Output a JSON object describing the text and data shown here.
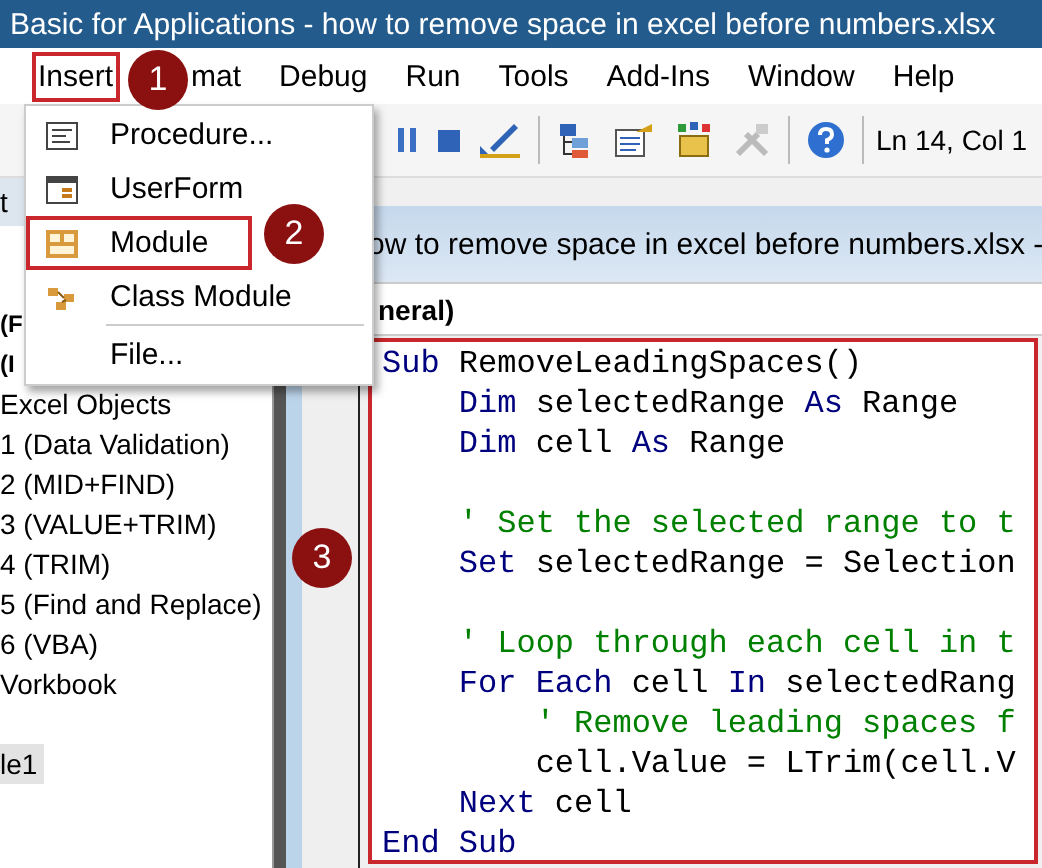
{
  "window": {
    "title": "Basic for Applications - how to remove space in excel before numbers.xlsx"
  },
  "menu_bar": {
    "items": [
      {
        "label": "Insert",
        "marked": true
      },
      {
        "label": "mat",
        "marked": false
      },
      {
        "label": "Debug",
        "marked": false
      },
      {
        "label": "Run",
        "marked": false
      },
      {
        "label": "Tools",
        "marked": false
      },
      {
        "label": "Add-Ins",
        "marked": false
      },
      {
        "label": "Window",
        "marked": false
      },
      {
        "label": "Help",
        "marked": false
      }
    ]
  },
  "insert_menu": {
    "items": [
      {
        "kind": "item",
        "label": "Procedure...",
        "marked": false
      },
      {
        "kind": "item",
        "label": "UserForm",
        "marked": false
      },
      {
        "kind": "item",
        "label": "Module",
        "marked": true
      },
      {
        "kind": "item",
        "label": "Class Module",
        "marked": false
      },
      {
        "kind": "separator"
      },
      {
        "kind": "item",
        "label": "File...",
        "marked": false
      }
    ]
  },
  "toolbar": {
    "position": "Ln 14, Col 1"
  },
  "project_pane": {
    "header": "t",
    "items": [
      {
        "label": "(F",
        "bold": true,
        "selected": false
      },
      {
        "label": "(I",
        "bold": true,
        "selected": false
      },
      {
        "label": "Excel Objects",
        "bold": false,
        "selected": false
      },
      {
        "label": "1 (Data Validation)",
        "bold": false,
        "selected": false
      },
      {
        "label": "2 (MID+FIND)",
        "bold": false,
        "selected": false
      },
      {
        "label": "3 (VALUE+TRIM)",
        "bold": false,
        "selected": false
      },
      {
        "label": "4 (TRIM)",
        "bold": false,
        "selected": false
      },
      {
        "label": "5 (Find and Replace)",
        "bold": false,
        "selected": false
      },
      {
        "label": "6 (VBA)",
        "bold": false,
        "selected": false
      },
      {
        "label": "Vorkbook",
        "bold": false,
        "selected": false
      },
      {
        "label": "le1",
        "bold": false,
        "selected": true
      }
    ]
  },
  "code_window": {
    "title": "ow to remove space in excel before numbers.xlsx -",
    "object_box": "neral)",
    "marked": true,
    "lines": [
      {
        "kind": "code",
        "segments": [
          {
            "kind": "keyword",
            "text": "Sub"
          },
          {
            "kind": "plain",
            "text": " RemoveLeadingSpaces()"
          }
        ]
      },
      {
        "kind": "code",
        "segments": [
          {
            "kind": "keyword",
            "text": "    Dim"
          },
          {
            "kind": "plain",
            "text": " selectedRange "
          },
          {
            "kind": "keyword",
            "text": "As"
          },
          {
            "kind": "plain",
            "text": " Range"
          }
        ]
      },
      {
        "kind": "code",
        "segments": [
          {
            "kind": "keyword",
            "text": "    Dim"
          },
          {
            "kind": "plain",
            "text": " cell "
          },
          {
            "kind": "keyword",
            "text": "As"
          },
          {
            "kind": "plain",
            "text": " Range"
          }
        ]
      },
      {
        "kind": "blank"
      },
      {
        "kind": "code",
        "segments": [
          {
            "kind": "comment",
            "text": "    ' Set the selected range to t"
          }
        ]
      },
      {
        "kind": "code",
        "segments": [
          {
            "kind": "keyword",
            "text": "    Set"
          },
          {
            "kind": "plain",
            "text": " selectedRange = Selection"
          }
        ]
      },
      {
        "kind": "blank"
      },
      {
        "kind": "code",
        "segments": [
          {
            "kind": "comment",
            "text": "    ' Loop through each cell in t"
          }
        ]
      },
      {
        "kind": "code",
        "segments": [
          {
            "kind": "keyword",
            "text": "    For Each"
          },
          {
            "kind": "plain",
            "text": " cell "
          },
          {
            "kind": "keyword",
            "text": "In"
          },
          {
            "kind": "plain",
            "text": " selectedRang"
          }
        ]
      },
      {
        "kind": "code",
        "segments": [
          {
            "kind": "comment",
            "text": "        ' Remove leading spaces f"
          }
        ]
      },
      {
        "kind": "code",
        "segments": [
          {
            "kind": "plain",
            "text": "        cell.Value = LTrim(cell.V"
          }
        ]
      },
      {
        "kind": "code",
        "segments": [
          {
            "kind": "keyword",
            "text": "    Next"
          },
          {
            "kind": "plain",
            "text": " cell"
          }
        ]
      },
      {
        "kind": "code",
        "segments": [
          {
            "kind": "keyword",
            "text": "End Sub"
          }
        ]
      }
    ]
  },
  "callouts": [
    {
      "number": "1"
    },
    {
      "number": "2"
    },
    {
      "number": "3"
    }
  ]
}
